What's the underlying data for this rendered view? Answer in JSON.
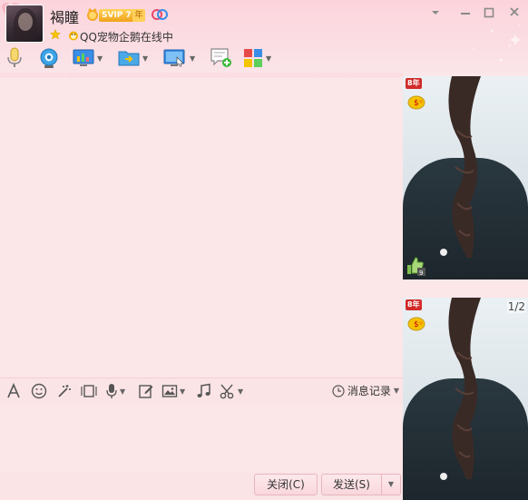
{
  "header": {
    "nickname": "褐瞳",
    "svip_badge": "SVIP 7",
    "year_badge": "年",
    "status_text": "QQ宠物企鹅在线中"
  },
  "window_controls": [
    "dropdown",
    "minimize",
    "maximize",
    "close"
  ],
  "toolbar_icons": [
    "voice-call",
    "video-call",
    "remote-desktop",
    "send-file",
    "screen-share",
    "message-app",
    "apps"
  ],
  "input_toolbar": {
    "history_label": "消息记录"
  },
  "buttons": {
    "close_label": "关闭(C)",
    "send_label": "发送(S)"
  },
  "photo_panel": {
    "vip_tag_1": "8年",
    "vip_tag_2": "8年",
    "counter": "1/2"
  },
  "colors": {
    "background": "#fbe6e8",
    "header_pink": "#fcd4dc",
    "button_border": "#e8b6be",
    "vip_gold": "#f0a21a"
  }
}
